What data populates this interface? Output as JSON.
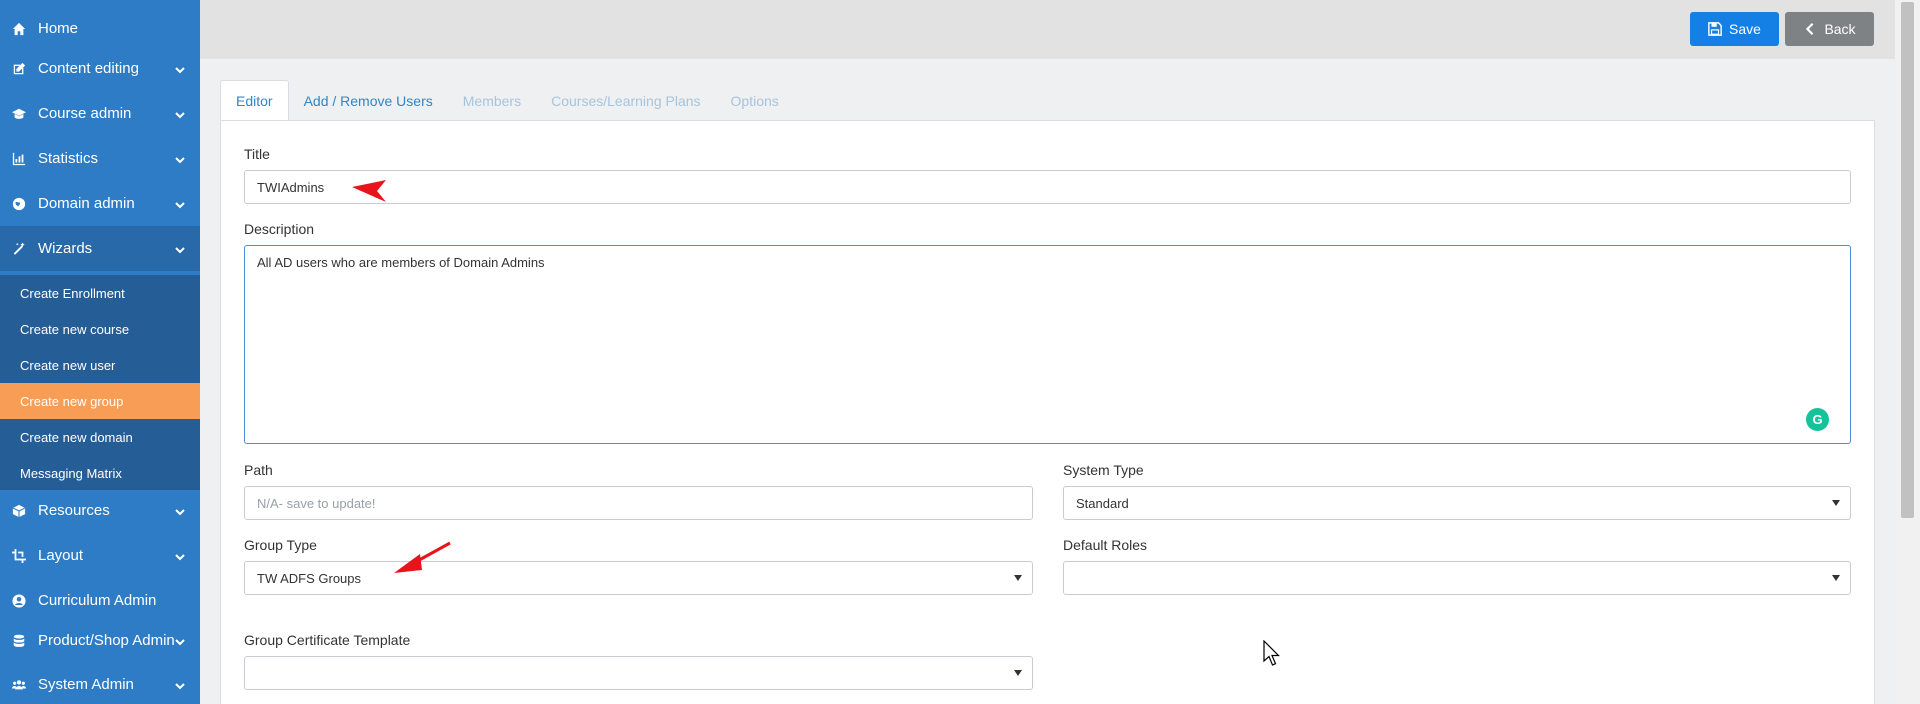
{
  "sidebar": {
    "items": [
      {
        "label": "Home",
        "icon": "home-icon"
      },
      {
        "label": "Content editing",
        "icon": "edit-icon"
      },
      {
        "label": "Course admin",
        "icon": "graduation-cap-icon"
      },
      {
        "label": "Statistics",
        "icon": "bar-chart-icon"
      },
      {
        "label": "Domain admin",
        "icon": "globe-icon"
      },
      {
        "label": "Wizards",
        "icon": "magic-wand-icon"
      },
      {
        "label": "Resources",
        "icon": "cube-icon"
      },
      {
        "label": "Layout",
        "icon": "crop-icon"
      },
      {
        "label": "Curriculum Admin",
        "icon": "user-circle-icon"
      },
      {
        "label": "Product/Shop Admin",
        "icon": "database-icon"
      },
      {
        "label": "System Admin",
        "icon": "users-icon"
      }
    ],
    "wizard_subitems": [
      "Create Enrollment",
      "Create new course",
      "Create new user",
      "Create new group",
      "Create new domain",
      "Messaging Matrix"
    ]
  },
  "toolbar": {
    "save_label": "Save",
    "back_label": "Back"
  },
  "tabs": [
    "Editor",
    "Add / Remove Users",
    "Members",
    "Courses/Learning Plans",
    "Options"
  ],
  "form": {
    "title_label": "Title",
    "title_value": "TWIAdmins",
    "description_label": "Description",
    "description_value": "All AD users who are members  of Domain Admins",
    "path_label": "Path",
    "path_placeholder": "N/A- save to update!",
    "system_type_label": "System Type",
    "system_type_value": "Standard",
    "group_type_label": "Group Type",
    "group_type_value": "TW ADFS Groups",
    "default_roles_label": "Default Roles",
    "default_roles_value": "",
    "certificate_label": "Group Certificate Template",
    "certificate_value": ""
  },
  "colors": {
    "sidebar": "#2f7cc6",
    "active_sub": "#f89d55",
    "save": "#1480e6",
    "back": "#7f8285",
    "annotation_arrow": "#e8141b"
  }
}
